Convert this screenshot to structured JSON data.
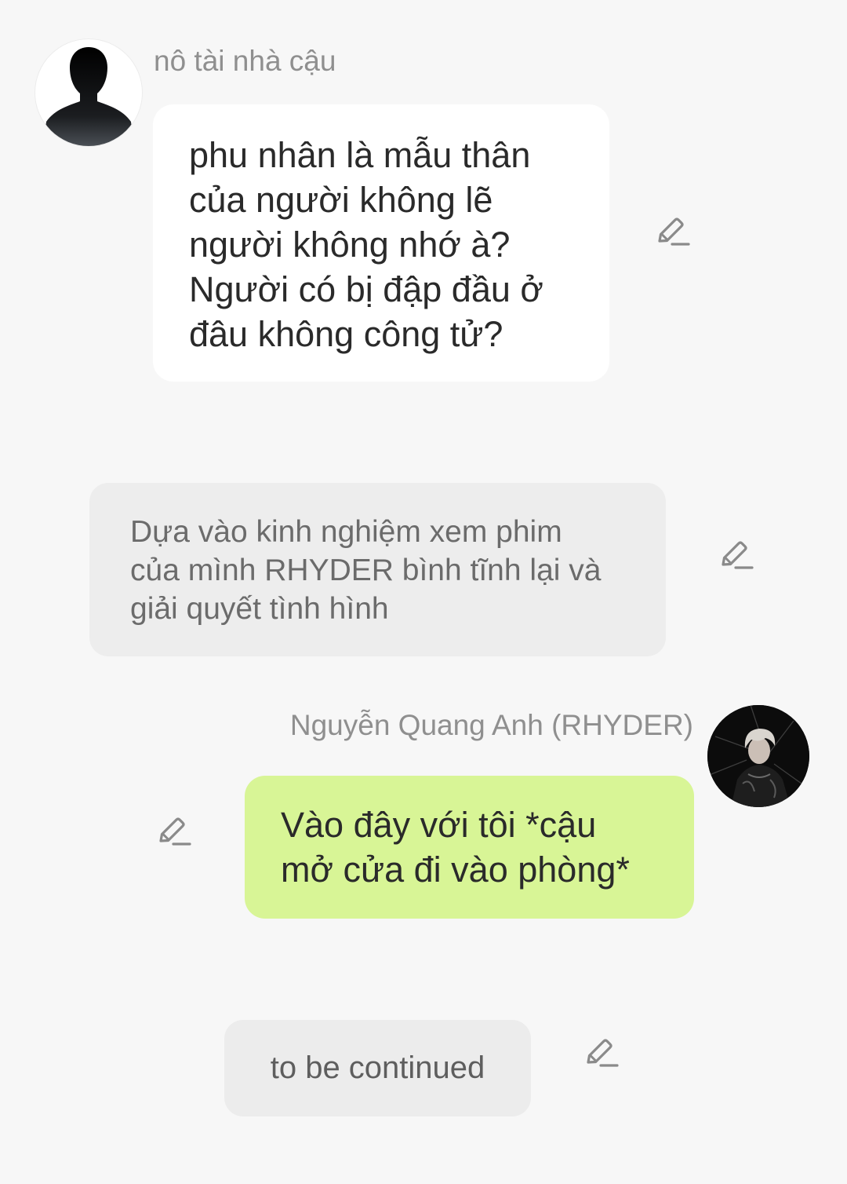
{
  "messages": [
    {
      "sender": "nô tài nhà cậu",
      "avatar_icon": "silhouette-avatar-icon",
      "lines": [
        "phu nhân là mẫu thân",
        "của người không lẽ",
        "người không nhớ à?",
        "Người có bị đập đầu ở",
        "đâu không công tử?"
      ],
      "bubble_color": "#ffffff"
    },
    {
      "type": "narration",
      "lines": [
        "Dựa vào kinh nghiệm xem phim",
        "của mình RHYDER bình tĩnh lại và",
        "giải quyết tình hình"
      ],
      "bubble_color": "#ededed"
    },
    {
      "sender": "Nguyễn Quang Anh (RHYDER)",
      "avatar_icon": "profile-photo-avatar",
      "lines": [
        "Vào đây với tôi *cậu",
        "mở cửa đi vào phòng*"
      ],
      "bubble_color": "#d8f596"
    },
    {
      "type": "narration",
      "text": "to be continued",
      "bubble_color": "#ececec"
    }
  ],
  "icons": {
    "edit": "pencil-edit-icon"
  },
  "colors": {
    "background": "#f7f7f7",
    "sender_name": "#8f8f8f",
    "icon": "#8a8a8a"
  }
}
